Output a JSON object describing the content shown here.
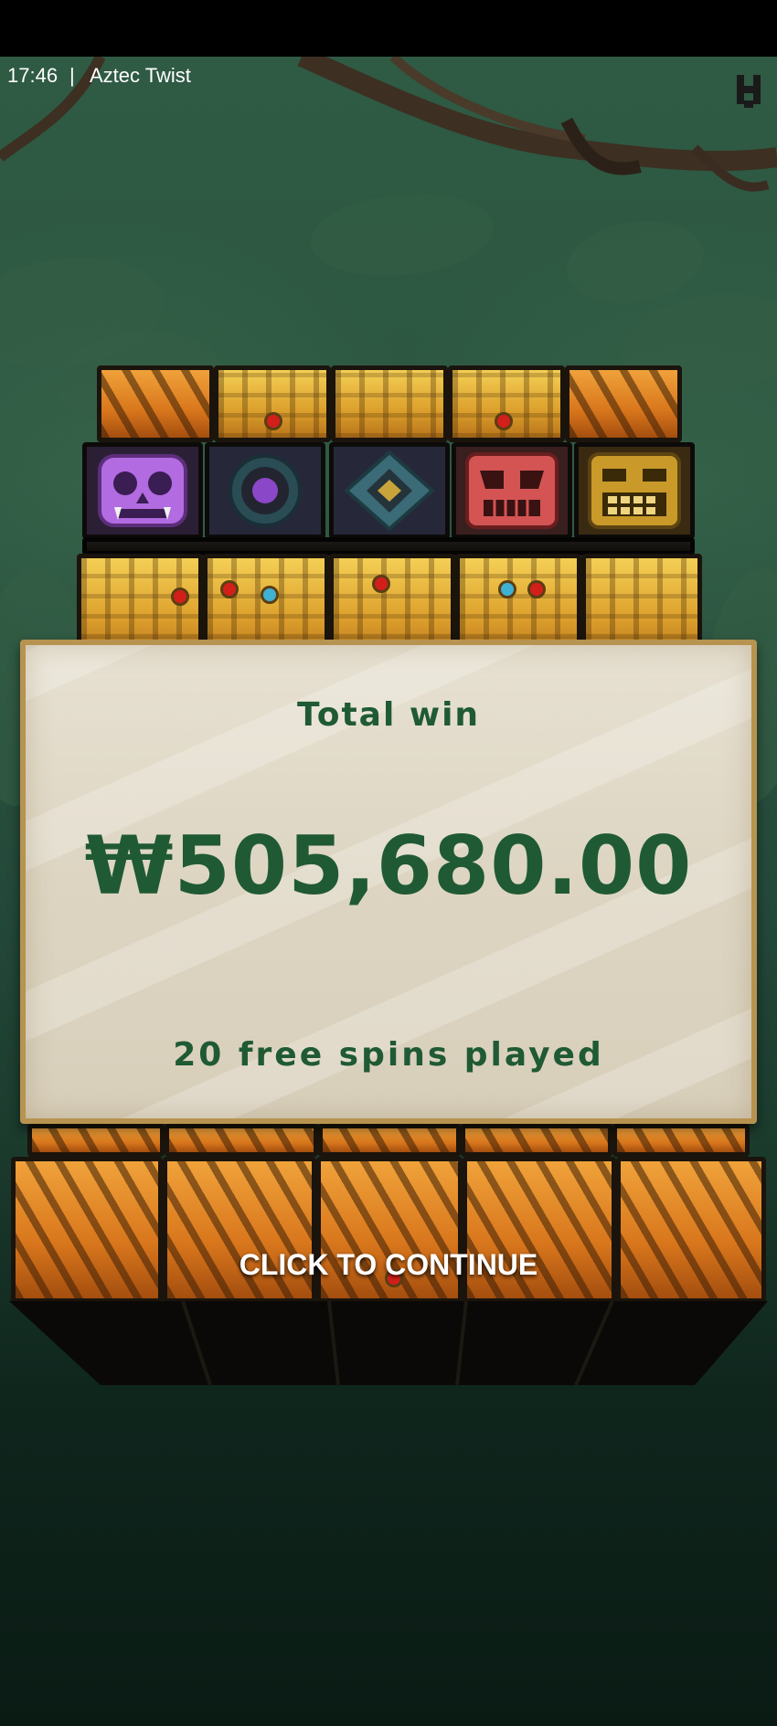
{
  "status_bar": {
    "time": "17:46",
    "separator": "|",
    "app_title": "Aztec Twist"
  },
  "win_panel": {
    "title": "Total win",
    "amount": "₩505,680.00",
    "subtitle": "20 free spins played"
  },
  "continue_label": "CLICK TO CONTINUE",
  "symbols": [
    {
      "name": "purple-skull-icon",
      "color": "#b26be0"
    },
    {
      "name": "purple-ring-icon",
      "color": "#8a47c7"
    },
    {
      "name": "gold-diamond-icon",
      "color": "#c9a43a"
    },
    {
      "name": "red-mask-icon",
      "color": "#d45454"
    },
    {
      "name": "gold-mask-icon",
      "color": "#c99a2a"
    }
  ],
  "colors": {
    "text_green": "#1f5a34",
    "panel_bg": "#e7e1d2",
    "panel_border": "#b79350",
    "jungle_green": "#2c5640"
  }
}
